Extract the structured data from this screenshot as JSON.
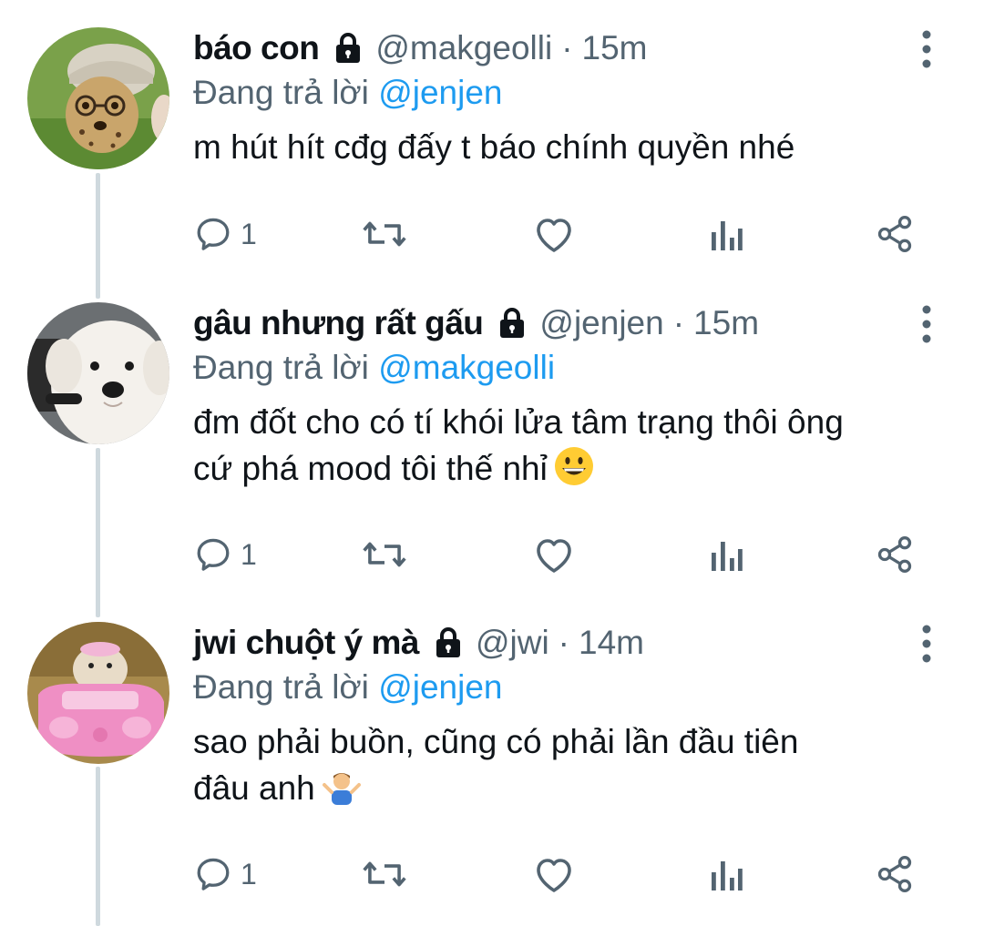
{
  "theme": {
    "text": "#0f1419",
    "muted": "#536471",
    "accent": "#1d9bf0",
    "thread_line": "#cfd9de"
  },
  "tweets": [
    {
      "display_name": "báo con",
      "handle": "@makgeolli",
      "separator": "·",
      "time": "15m",
      "reply_prefix": "Đang trả lời",
      "reply_to": "@jenjen",
      "body_lines": [
        "m hút hít cđg đấy t báo chính quyền nhé"
      ],
      "emoji": "",
      "reply_count": "1",
      "avatar_icon": "cheetah-cub-avatar",
      "locked": true
    },
    {
      "display_name": "gâu nhưng rất gấu",
      "handle": "@jenjen",
      "separator": "·",
      "time": "15m",
      "reply_prefix": "Đang trả lời",
      "reply_to": "@makgeolli",
      "body_lines": [
        "đm đốt cho có tí khói lửa tâm trạng thôi ông",
        "cứ phá mood tôi thế nhỉ"
      ],
      "emoji": "grinning-face-emoji",
      "reply_count": "1",
      "avatar_icon": "white-dog-avatar",
      "locked": true
    },
    {
      "display_name": "jwi chuột ý mà",
      "handle": "@jwi",
      "separator": "·",
      "time": "14m",
      "reply_prefix": "Đang trả lời",
      "reply_to": "@jenjen",
      "body_lines": [
        "sao phải buồn, cũng có phải lần đầu tiên",
        "đâu anh"
      ],
      "emoji": "person-shrugging-emoji",
      "reply_count": "1",
      "avatar_icon": "hamster-pink-car-avatar",
      "locked": true
    }
  ]
}
